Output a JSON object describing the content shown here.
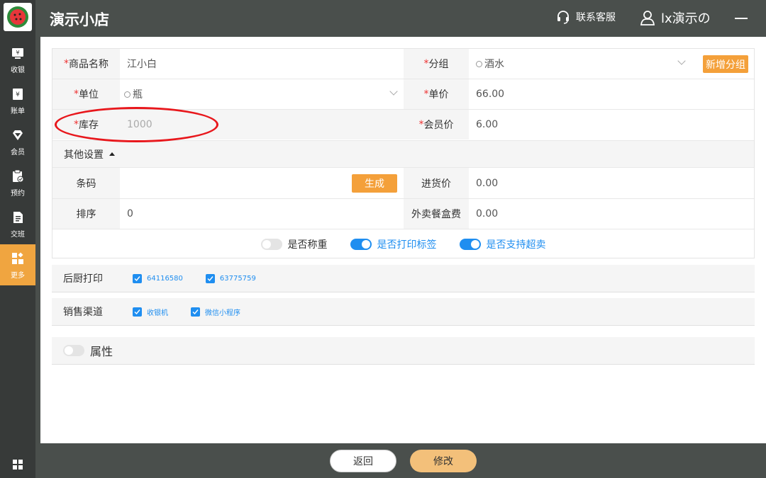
{
  "sidebar": {
    "items": [
      {
        "label": "收银",
        "icon": "cashier-icon"
      },
      {
        "label": "账单",
        "icon": "bill-icon"
      },
      {
        "label": "会员",
        "icon": "member-icon"
      },
      {
        "label": "预约",
        "icon": "booking-icon"
      },
      {
        "label": "交班",
        "icon": "handover-icon"
      },
      {
        "label": "更多",
        "icon": "more-icon"
      }
    ]
  },
  "header": {
    "title": "演示小店",
    "customer_service": "联系客服",
    "user": "lx演示の"
  },
  "form": {
    "product_name": {
      "label": "商品名称",
      "value": "江小白"
    },
    "group": {
      "label": "分组",
      "value": "酒水",
      "add_button": "新增分组"
    },
    "unit": {
      "label": "单位",
      "value": "瓶"
    },
    "price": {
      "label": "单价",
      "value": "66.00"
    },
    "stock": {
      "label": "库存",
      "placeholder": "1000"
    },
    "member_price": {
      "label": "会员价",
      "value": "6.00"
    },
    "other_settings": "其他设置",
    "barcode": {
      "label": "条码",
      "value": "",
      "generate_button": "生成"
    },
    "purchase_price": {
      "label": "进货价",
      "value": "0.00"
    },
    "sort": {
      "label": "排序",
      "value": "0"
    },
    "box_fee": {
      "label": "外卖餐盒费",
      "value": "0.00"
    },
    "toggles": [
      {
        "label": "是否称重",
        "on": false
      },
      {
        "label": "是否打印标签",
        "on": true
      },
      {
        "label": "是否支持超卖",
        "on": true
      }
    ]
  },
  "kitchen_print": {
    "title": "后厨打印",
    "options": [
      "64116580",
      "63775759"
    ]
  },
  "sales_channel": {
    "title": "销售渠道",
    "options": [
      "收银机",
      "微信小程序"
    ]
  },
  "attributes": {
    "label": "属性",
    "on": false
  },
  "footer": {
    "return_label": "返回",
    "modify_label": "修改"
  },
  "colors": {
    "accent": "#f4a03a",
    "toggle_on": "#1f8ef0",
    "annotation": "#e8171c"
  }
}
